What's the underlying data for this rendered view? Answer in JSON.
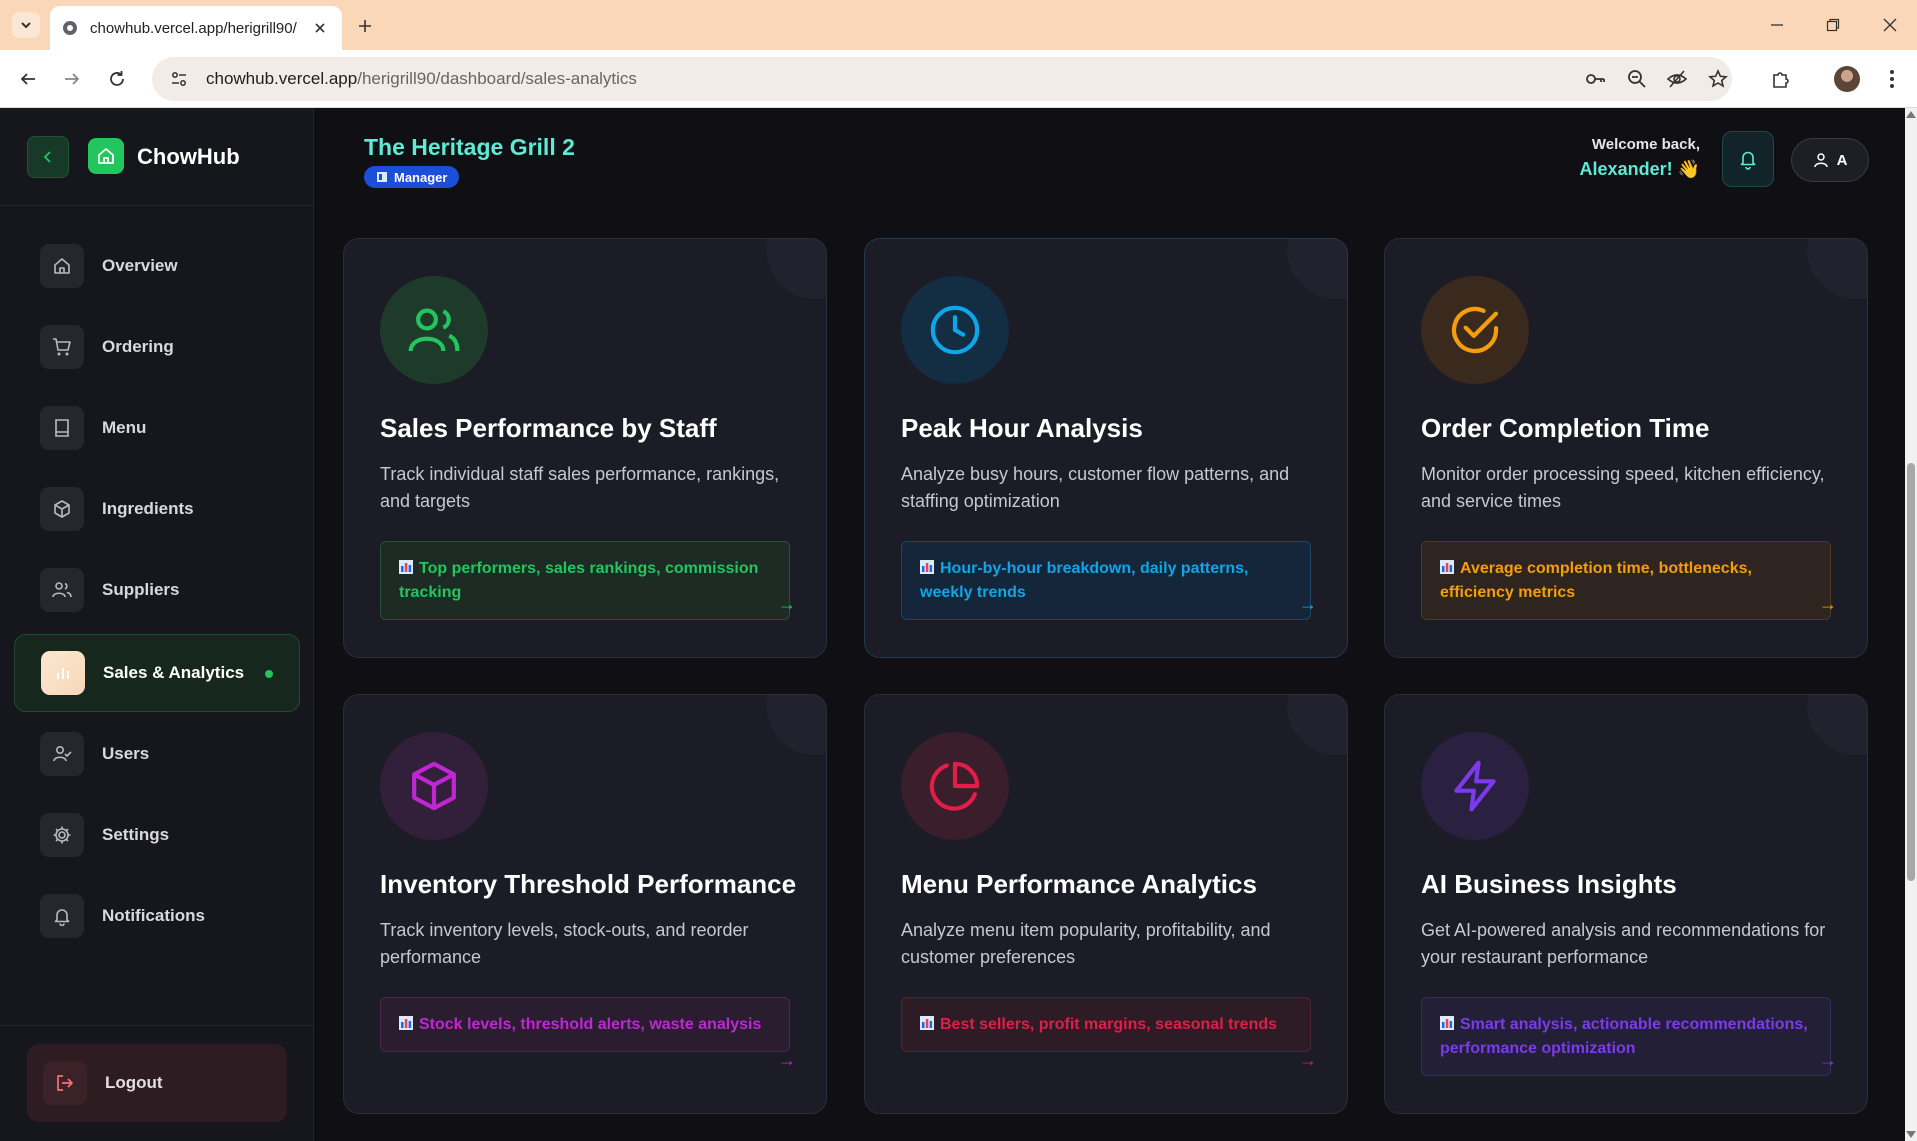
{
  "browser": {
    "tab_title": "chowhub.vercel.app/herigrill90/",
    "url_domain": "chowhub.vercel.app",
    "url_path": "/herigrill90/dashboard/sales-analytics"
  },
  "sidebar": {
    "brand": "ChowHub",
    "items": [
      {
        "label": "Overview",
        "icon": "home-icon"
      },
      {
        "label": "Ordering",
        "icon": "cart-icon"
      },
      {
        "label": "Menu",
        "icon": "book-icon"
      },
      {
        "label": "Ingredients",
        "icon": "box-icon"
      },
      {
        "label": "Suppliers",
        "icon": "users-icon"
      },
      {
        "label": "Sales & Analytics",
        "icon": "bar-chart-icon",
        "active": true
      },
      {
        "label": "Users",
        "icon": "user-check-icon"
      },
      {
        "label": "Settings",
        "icon": "gear-icon"
      },
      {
        "label": "Notifications",
        "icon": "bell-icon"
      }
    ],
    "logout": "Logout"
  },
  "header": {
    "restaurant": "The Heritage Grill 2",
    "role": "Manager",
    "welcome_line": "Welcome back,",
    "welcome_name": "Alexander! 👋",
    "user_initial": "A"
  },
  "cards": [
    {
      "title": "Sales Performance by Staff",
      "desc": "Track individual staff sales performance, rankings, and targets",
      "tag": "Top performers, sales rankings, commission tracking",
      "arrow": "→",
      "color": "#22c55e",
      "icon": "users-icon"
    },
    {
      "title": "Peak Hour Analysis",
      "desc": "Analyze busy hours, customer flow patterns, and staffing optimization",
      "tag": "Hour-by-hour breakdown, daily patterns, weekly trends",
      "arrow": "→",
      "color": "#0ea5e9",
      "icon": "clock-icon"
    },
    {
      "title": "Order Completion Time",
      "desc": "Monitor order processing speed, kitchen efficiency, and service times",
      "tag": "Average completion time, bottlenecks, efficiency metrics",
      "arrow": "→",
      "color": "#f59e0b",
      "icon": "check-circle-icon"
    },
    {
      "title": "Inventory Threshold Performance",
      "desc": "Track inventory levels, stock-outs, and reorder performance",
      "tag": "Stock levels, threshold alerts, waste analysis",
      "arrow": "→",
      "color": "#c026d3",
      "icon": "cube-icon"
    },
    {
      "title": "Menu Performance Analytics",
      "desc": "Analyze menu item popularity, profitability, and customer preferences",
      "tag": "Best sellers, profit margins, seasonal trends",
      "arrow": "→",
      "color": "#e11d48",
      "icon": "pie-chart-icon"
    },
    {
      "title": "AI Business Insights",
      "desc": "Get AI-powered analysis and recommendations for your restaurant performance",
      "tag": "Smart analysis, actionable recommendations, performance optimization",
      "arrow": "→",
      "color": "#7c3aed",
      "icon": "lightning-icon"
    }
  ]
}
